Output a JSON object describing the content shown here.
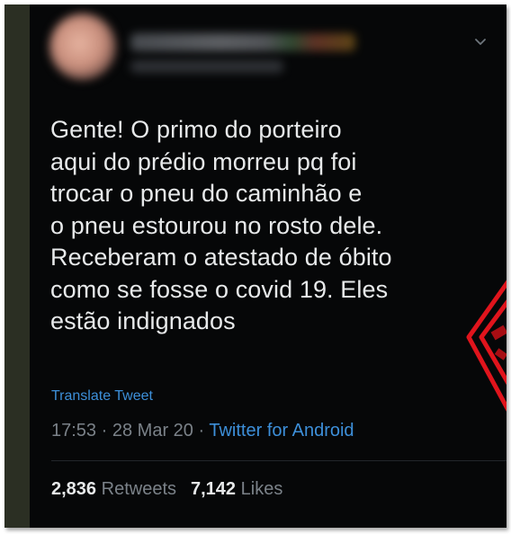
{
  "tweet": {
    "text_lines": [
      "Gente! O primo do porteiro",
      "aqui do prédio morreu pq foi",
      "trocar o pneu do caminhão e",
      "o pneu estourou no rosto dele.",
      "Receberam o atestado de óbito",
      "como se fosse o covid 19. Eles",
      "estão indignados"
    ],
    "translate_label": "Translate Tweet",
    "time": "17:53",
    "separator": "·",
    "date": "28 Mar 20",
    "source": "Twitter for Android",
    "retweets_count": "2,836",
    "retweets_label": "Retweets",
    "likes_count": "7,142",
    "likes_label": "Likes"
  },
  "icons": {
    "menu": "chevron-down-icon"
  },
  "colors": {
    "background": "#060708",
    "text": "#e7e9ea",
    "link": "#3d8fd9",
    "muted": "#7b8289",
    "stamp": "#e0141c"
  }
}
